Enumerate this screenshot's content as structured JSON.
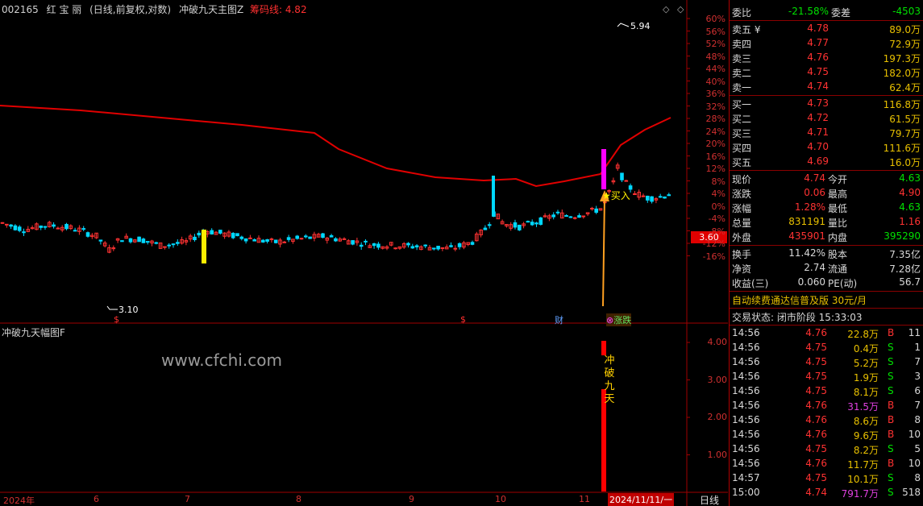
{
  "header": {
    "code": "002165",
    "name": "红 宝 丽",
    "period": "(日线,前复权,对数)",
    "indicator": "冲破九天主图Z",
    "chip_label": "筹码线: 4.82"
  },
  "sub_header": {
    "indicator": "冲破九天幅图F"
  },
  "watermark": "www.cfchi.com",
  "price_tag": "3.60",
  "pct_axis": [
    "60%",
    "56%",
    "52%",
    "48%",
    "44%",
    "40%",
    "36%",
    "32%",
    "28%",
    "24%",
    "20%",
    "16%",
    "12%",
    "8%",
    "4%",
    "0%",
    "-4%",
    "-8%",
    "-12%",
    "-16%"
  ],
  "sub_axis": [
    "4.00",
    "3.00",
    "2.00",
    "1.00"
  ],
  "x_axis": {
    "labels": [
      "2024年",
      "6",
      "7",
      "8",
      "9",
      "10",
      "11"
    ],
    "current_date": "2024/11/11/一",
    "period_button": "日线"
  },
  "annotations": {
    "high": "5.94",
    "low": "3.10",
    "buy": "买入",
    "vertical": [
      "冲",
      "破",
      "九",
      "天"
    ],
    "fin1": "$",
    "fin2": "$",
    "fin3": "财",
    "fin4": "涨跌"
  },
  "colors": {
    "up": "#ff3232",
    "down": "#00d8ff",
    "ma": "#e00000",
    "accent_yellow": "#ffee00",
    "magenta": "#ff00ff"
  },
  "quote": {
    "weibi_label": "委比",
    "weibi": "-21.58%",
    "weicha_label": "委差",
    "weicha": "-4503",
    "asks": [
      {
        "label": "卖五 ¥",
        "price": "4.78",
        "vol": "89.0万"
      },
      {
        "label": "卖四",
        "price": "4.77",
        "vol": "72.9万"
      },
      {
        "label": "卖三",
        "price": "4.76",
        "vol": "197.3万"
      },
      {
        "label": "卖二",
        "price": "4.75",
        "vol": "182.0万"
      },
      {
        "label": "卖一",
        "price": "4.74",
        "vol": "62.4万"
      }
    ],
    "bids": [
      {
        "label": "买一",
        "price": "4.73",
        "vol": "116.8万"
      },
      {
        "label": "买二",
        "price": "4.72",
        "vol": "61.5万"
      },
      {
        "label": "买三",
        "price": "4.71",
        "vol": "79.7万"
      },
      {
        "label": "买四",
        "price": "4.70",
        "vol": "111.6万"
      },
      {
        "label": "买五",
        "price": "4.69",
        "vol": "16.0万"
      }
    ],
    "stats": [
      {
        "l1": "现价",
        "v1": "4.74",
        "c1": "r",
        "l2": "今开",
        "v2": "4.63",
        "c2": "g"
      },
      {
        "l1": "涨跌",
        "v1": "0.06",
        "c1": "r",
        "l2": "最高",
        "v2": "4.90",
        "c2": "r"
      },
      {
        "l1": "涨幅",
        "v1": "1.28%",
        "c1": "r",
        "l2": "最低",
        "v2": "4.63",
        "c2": "g"
      },
      {
        "l1": "总量",
        "v1": "831191",
        "c1": "y",
        "l2": "量比",
        "v2": "1.16",
        "c2": "r"
      },
      {
        "l1": "外盘",
        "v1": "435901",
        "c1": "r",
        "l2": "内盘",
        "v2": "395290",
        "c2": "g"
      }
    ],
    "stats2": [
      {
        "l1": "换手",
        "v1": "11.42%",
        "l2": "股本",
        "v2": "7.35亿"
      },
      {
        "l1": "净资",
        "v1": "2.74",
        "l2": "流通",
        "v2": "7.28亿"
      },
      {
        "l1": "收益(三)",
        "v1": "0.060",
        "l2": "PE(动)",
        "v2": "56.7"
      }
    ],
    "promo": "自动续费通达信普及版  30元/月",
    "status": "交易状态: 闭市阶段 15:33:03",
    "ticks": [
      {
        "t": "14:56",
        "p": "4.76",
        "v": "22.8万",
        "bs": "B",
        "n": "11",
        "vc": "y"
      },
      {
        "t": "14:56",
        "p": "4.75",
        "v": "0.4万",
        "bs": "S",
        "n": "1",
        "vc": "y"
      },
      {
        "t": "14:56",
        "p": "4.75",
        "v": "5.2万",
        "bs": "S",
        "n": "7",
        "vc": "y"
      },
      {
        "t": "14:56",
        "p": "4.75",
        "v": "1.9万",
        "bs": "S",
        "n": "3",
        "vc": "y"
      },
      {
        "t": "14:56",
        "p": "4.75",
        "v": "8.1万",
        "bs": "S",
        "n": "6",
        "vc": "y"
      },
      {
        "t": "14:56",
        "p": "4.76",
        "v": "31.5万",
        "bs": "B",
        "n": "7",
        "vc": "m"
      },
      {
        "t": "14:56",
        "p": "4.76",
        "v": "8.6万",
        "bs": "B",
        "n": "8",
        "vc": "y"
      },
      {
        "t": "14:56",
        "p": "4.76",
        "v": "9.6万",
        "bs": "B",
        "n": "10",
        "vc": "y"
      },
      {
        "t": "14:56",
        "p": "4.75",
        "v": "8.2万",
        "bs": "S",
        "n": "5",
        "vc": "y"
      },
      {
        "t": "14:56",
        "p": "4.76",
        "v": "11.7万",
        "bs": "B",
        "n": "10",
        "vc": "y"
      },
      {
        "t": "14:57",
        "p": "4.75",
        "v": "10.1万",
        "bs": "S",
        "n": "8",
        "vc": "y"
      },
      {
        "t": "15:00",
        "p": "4.74",
        "v": "791.7万",
        "bs": "S",
        "n": "518",
        "vc": "m"
      }
    ]
  }
}
